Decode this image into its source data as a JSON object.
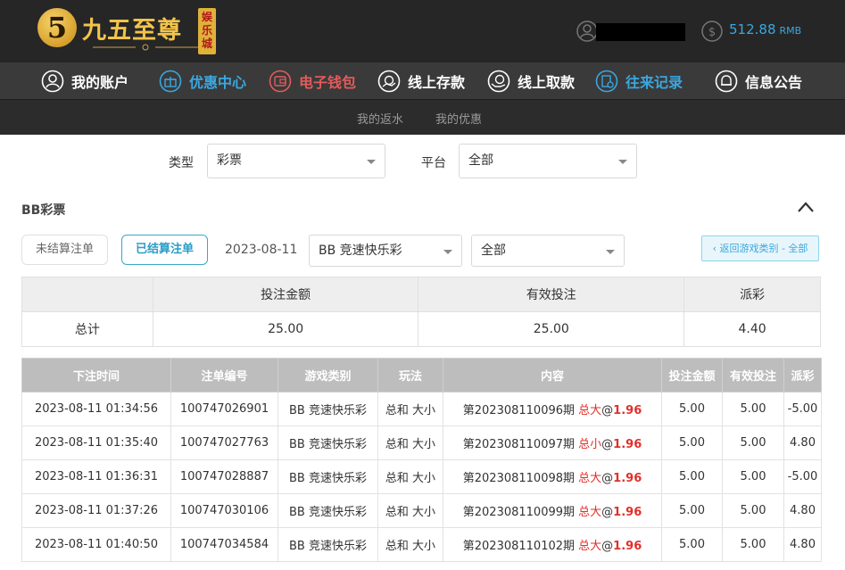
{
  "brand": {
    "logo_glyph": "5",
    "name": "九五至尊",
    "badge": "娱乐城"
  },
  "account": {
    "balance": "512.88",
    "unit": "RMB"
  },
  "nav": [
    {
      "label": "我的账户",
      "icon": "user-icon",
      "color": "white"
    },
    {
      "label": "优惠中心",
      "icon": "gift-icon",
      "color": "blue"
    },
    {
      "label": "电子钱包",
      "icon": "wallet-icon",
      "color": "red"
    },
    {
      "label": "线上存款",
      "icon": "deposit-icon",
      "color": "white"
    },
    {
      "label": "线上取款",
      "icon": "withdraw-icon",
      "color": "white"
    },
    {
      "label": "往来记录",
      "icon": "records-icon",
      "color": "blue"
    },
    {
      "label": "信息公告",
      "icon": "bell-icon",
      "color": "white"
    }
  ],
  "subnav": [
    "我的返水",
    "我的优惠"
  ],
  "filters": {
    "type_label": "类型",
    "type_value": "彩票",
    "platform_label": "平台",
    "platform_value": "全部"
  },
  "section": {
    "title": "BB彩票"
  },
  "controls": {
    "unsettled": "未结算注单",
    "settled": "已结算注单",
    "date": "2023-08-11",
    "game_select": "BB 竞速快乐彩",
    "play_select": "全部",
    "back": "‹ 返回游戏类别 - 全部"
  },
  "summary": {
    "headers": [
      "",
      "投注金额",
      "有效投注",
      "派彩"
    ],
    "row": [
      "总计",
      "25.00",
      "25.00",
      "4.40"
    ]
  },
  "table": {
    "headers": [
      "下注时间",
      "注单编号",
      "游戏类别",
      "玩法",
      "内容",
      "投注金额",
      "有效投注",
      "派彩"
    ],
    "rows": [
      {
        "time": "2023-08-11 01:34:56",
        "id": "100747026901",
        "game": "BB 竞速快乐彩",
        "play": "总和 大小",
        "period": "第202308110096期",
        "pick": "总大",
        "at": "@",
        "odds": "1.96",
        "amount": "5.00",
        "valid": "5.00",
        "payout": "-5.00",
        "neg": true
      },
      {
        "time": "2023-08-11 01:35:40",
        "id": "100747027763",
        "game": "BB 竞速快乐彩",
        "play": "总和 大小",
        "period": "第202308110097期",
        "pick": "总小",
        "at": "@",
        "odds": "1.96",
        "amount": "5.00",
        "valid": "5.00",
        "payout": "4.80",
        "neg": false
      },
      {
        "time": "2023-08-11 01:36:31",
        "id": "100747028887",
        "game": "BB 竞速快乐彩",
        "play": "总和 大小",
        "period": "第202308110098期",
        "pick": "总大",
        "at": "@",
        "odds": "1.96",
        "amount": "5.00",
        "valid": "5.00",
        "payout": "-5.00",
        "neg": true
      },
      {
        "time": "2023-08-11 01:37:26",
        "id": "100747030106",
        "game": "BB 竞速快乐彩",
        "play": "总和 大小",
        "period": "第202308110099期",
        "pick": "总大",
        "at": "@",
        "odds": "1.96",
        "amount": "5.00",
        "valid": "5.00",
        "payout": "4.80",
        "neg": false
      },
      {
        "time": "2023-08-11 01:40:50",
        "id": "100747034584",
        "game": "BB 竞速快乐彩",
        "play": "总和 大小",
        "period": "第202308110102期",
        "pick": "总大",
        "at": "@",
        "odds": "1.96",
        "amount": "5.00",
        "valid": "5.00",
        "payout": "4.80",
        "neg": false
      }
    ]
  }
}
